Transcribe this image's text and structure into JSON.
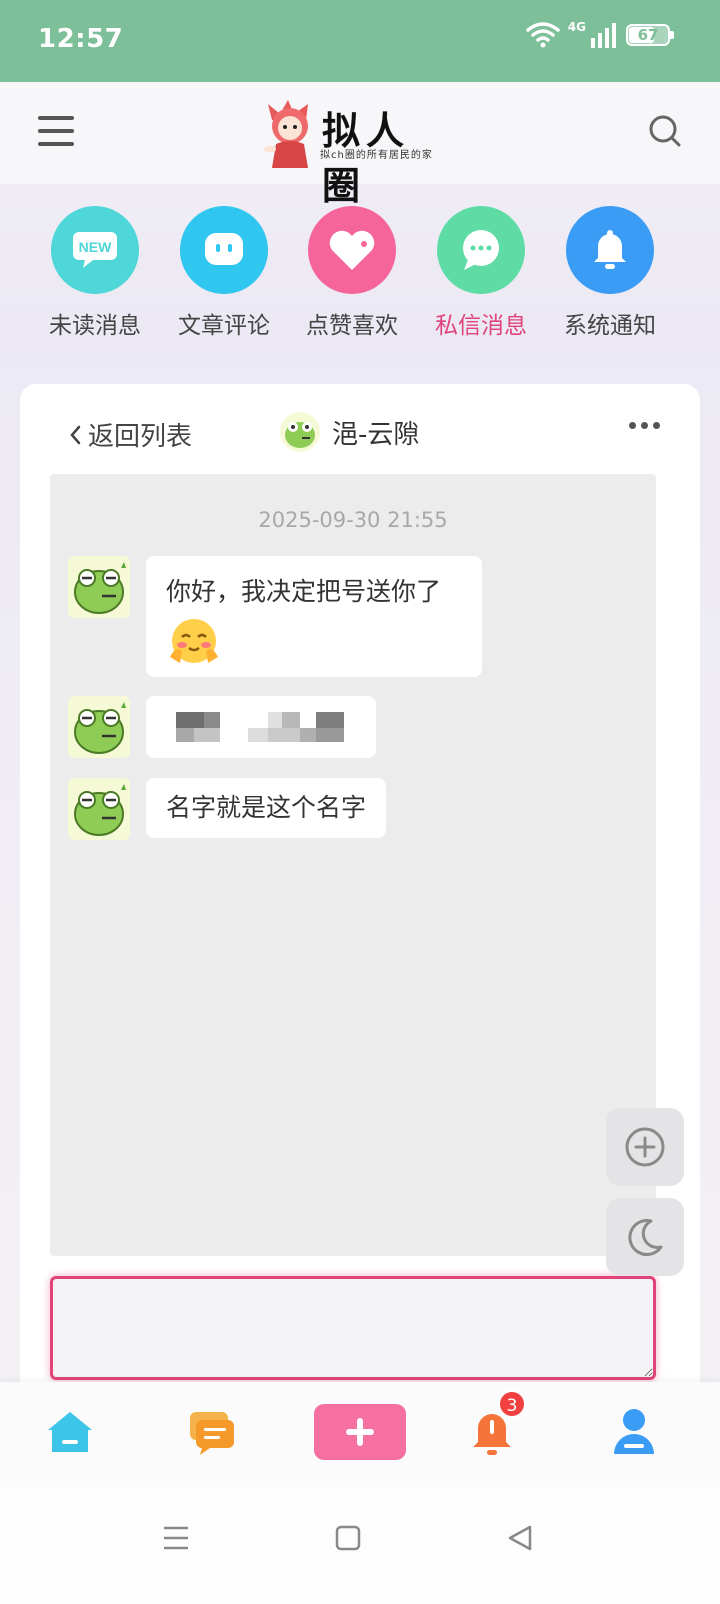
{
  "status_bar": {
    "time": "12:57",
    "network": "4G",
    "battery": "67",
    "icons": [
      "wifi-icon",
      "signal-icon",
      "battery-icon"
    ]
  },
  "header": {
    "logo_title": "拟人圈",
    "logo_subtitle": "拟ch圈的所有居民的家",
    "icons": [
      "menu-icon",
      "search-icon"
    ]
  },
  "categories": [
    {
      "label": "未读消息",
      "icon": "new-badge-icon",
      "color": "#4fd6d8",
      "active": false
    },
    {
      "label": "文章评论",
      "icon": "comment-face-icon",
      "color": "#2fc6ef",
      "active": false
    },
    {
      "label": "点赞喜欢",
      "icon": "heart-icon",
      "color": "#f5659a",
      "active": false
    },
    {
      "label": "私信消息",
      "icon": "chat-bubble-icon",
      "color": "#5fdca6",
      "active": true
    },
    {
      "label": "系统通知",
      "icon": "bell-icon",
      "color": "#3a9cf5",
      "active": false
    }
  ],
  "chat": {
    "back_label": "返回列表",
    "user_name": "浥-云隙",
    "timestamp": "2025-09-30 21:55",
    "messages": [
      {
        "text": "你好，我决定把号送你了",
        "emoji": "blush-emoji"
      },
      {
        "text": "",
        "pixelated": true
      },
      {
        "text": "名字就是这个名字"
      }
    ],
    "input_placeholder": ""
  },
  "floating": [
    "add-circle-icon",
    "moon-icon"
  ],
  "bottom_nav": {
    "items": [
      "home-icon",
      "messages-icon",
      "plus-icon",
      "bell-icon",
      "profile-icon"
    ],
    "notification_badge": "3"
  },
  "colors": {
    "accent": "#e0447a",
    "status_bar": "#7dbf98"
  }
}
